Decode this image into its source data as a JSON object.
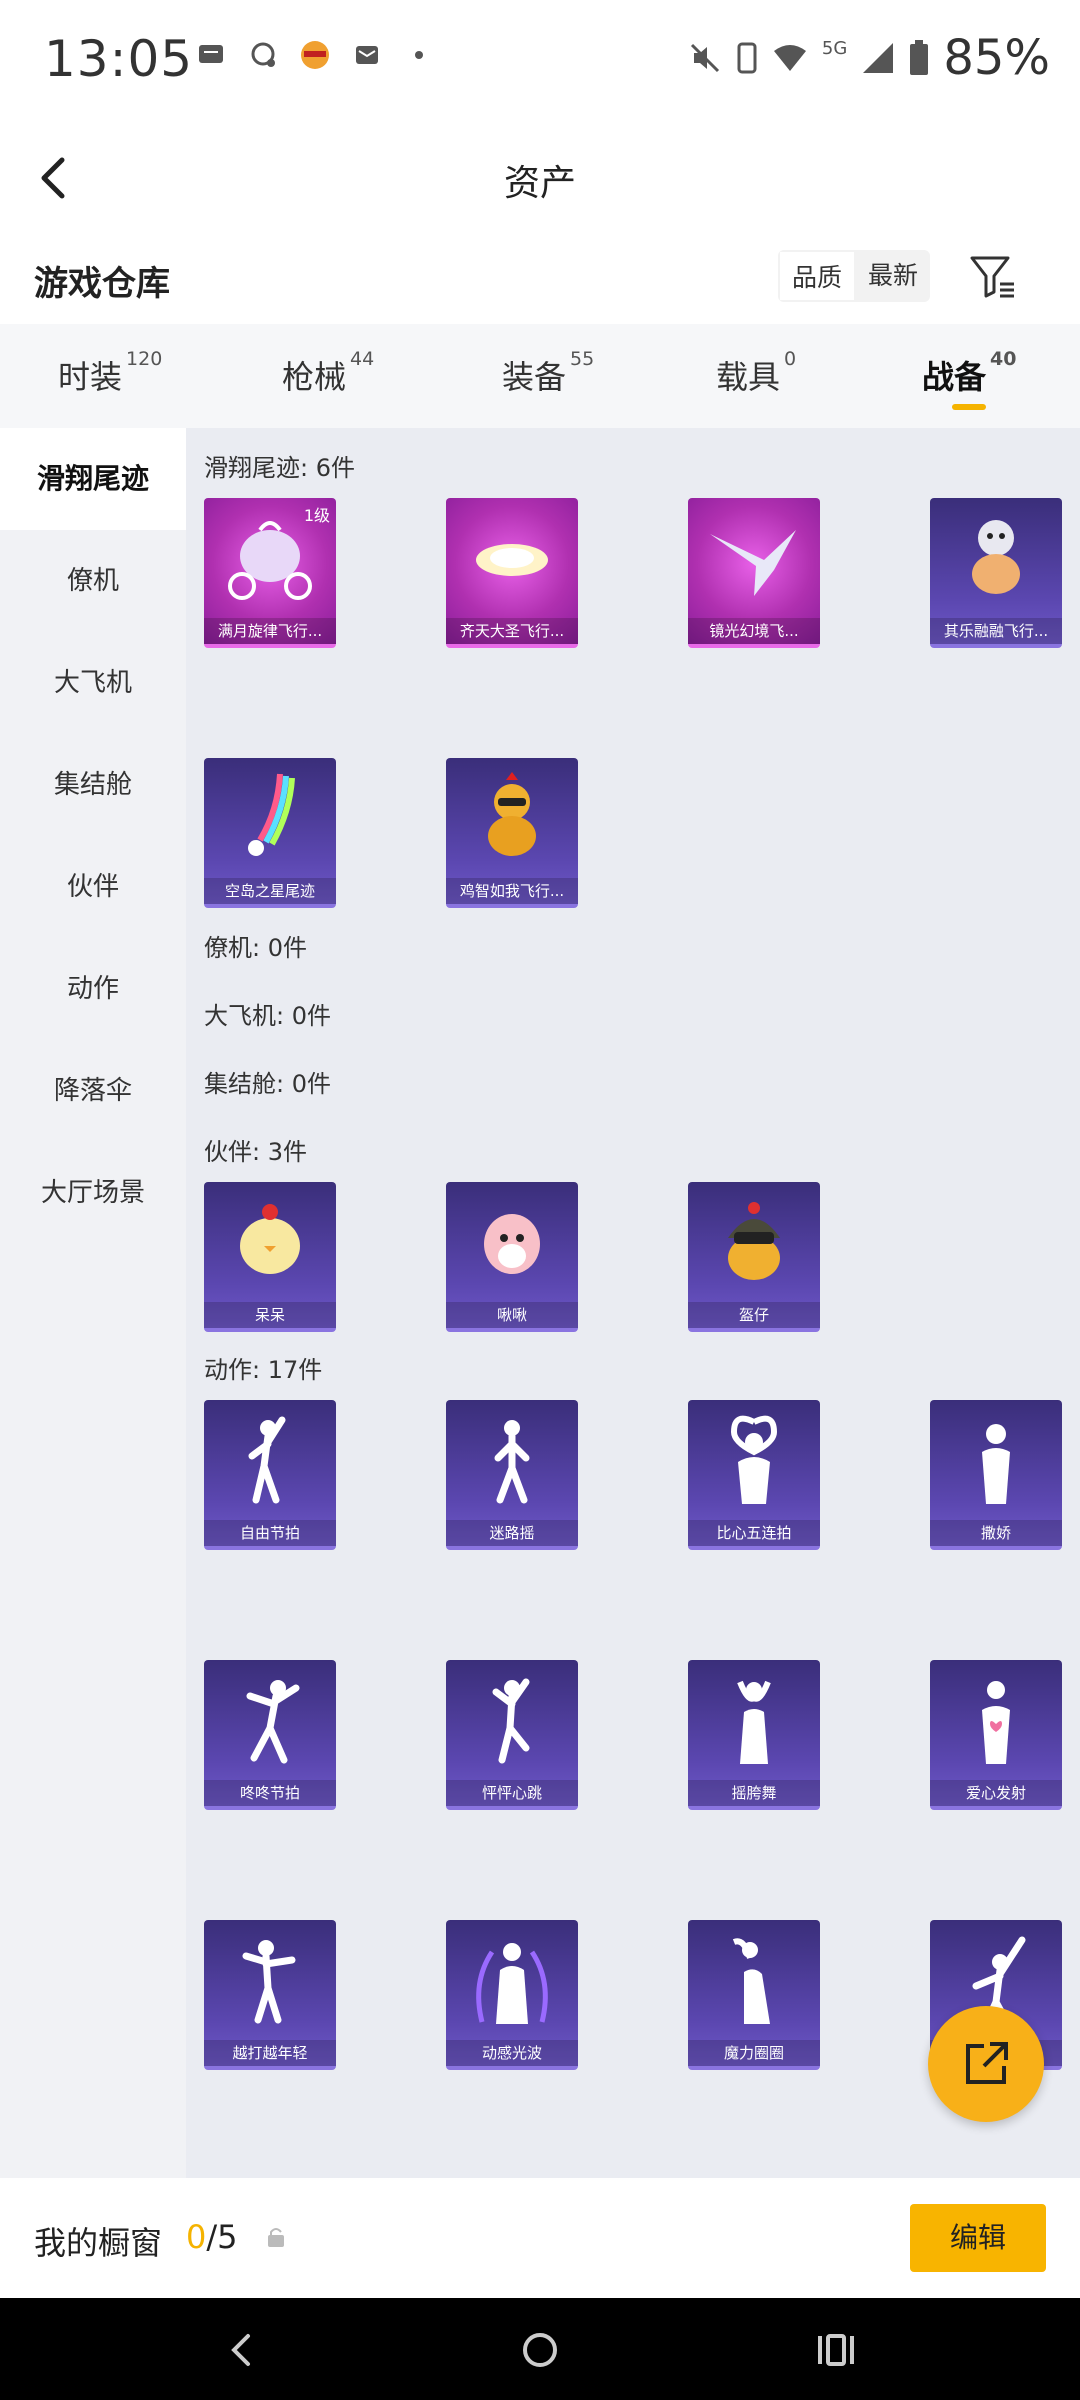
{
  "status_bar": {
    "time": "13:05",
    "battery": "85%",
    "network": "5G"
  },
  "header": {
    "title": "资产"
  },
  "warehouse": {
    "title": "游戏仓库",
    "sort_quality": "品质",
    "sort_newest": "最新"
  },
  "tabs": [
    {
      "label": "时装",
      "count": "120"
    },
    {
      "label": "枪械",
      "count": "44"
    },
    {
      "label": "装备",
      "count": "55"
    },
    {
      "label": "载具",
      "count": "0"
    },
    {
      "label": "战备",
      "count": "40"
    }
  ],
  "sidebar": [
    {
      "label": "滑翔尾迹"
    },
    {
      "label": "僚机"
    },
    {
      "label": "大飞机"
    },
    {
      "label": "集结舱"
    },
    {
      "label": "伙伴"
    },
    {
      "label": "动作"
    },
    {
      "label": "降落伞"
    },
    {
      "label": "大厅场景"
    }
  ],
  "sections": {
    "trail": {
      "label": "滑翔尾迹: 6件"
    },
    "wingman": {
      "label": "僚机: 0件"
    },
    "plane": {
      "label": "大飞机: 0件"
    },
    "pod": {
      "label": "集结舱: 0件"
    },
    "partner": {
      "label": "伙伴: 3件"
    },
    "emote": {
      "label": "动作: 17件"
    }
  },
  "trail_items": [
    {
      "name": "满月旋律飞行...",
      "level": "1级"
    },
    {
      "name": "齐天大圣飞行..."
    },
    {
      "name": "镜光幻境飞..."
    },
    {
      "name": "其乐融融飞行..."
    },
    {
      "name": "空岛之星尾迹"
    },
    {
      "name": "鸡智如我飞行..."
    }
  ],
  "partner_items": [
    {
      "name": "呆呆"
    },
    {
      "name": "啾啾"
    },
    {
      "name": "盔仔"
    }
  ],
  "emote_items": [
    {
      "name": "自由节拍"
    },
    {
      "name": "迷路摇"
    },
    {
      "name": "比心五连拍"
    },
    {
      "name": "撒娇"
    },
    {
      "name": "咚咚节拍"
    },
    {
      "name": "怦怦心跳"
    },
    {
      "name": "摇胯舞"
    },
    {
      "name": "爱心发射"
    },
    {
      "name": "越打越年轻"
    },
    {
      "name": "动感光波"
    },
    {
      "name": "魔力圈圈"
    },
    {
      "name": ""
    }
  ],
  "bottom": {
    "window_label": "我的橱窗",
    "used": "0",
    "total": "/5",
    "edit_label": "编辑"
  },
  "colors": {
    "accent": "#f8b400",
    "card_purple": "#5b47b0",
    "card_pink": "#c23cc8"
  }
}
